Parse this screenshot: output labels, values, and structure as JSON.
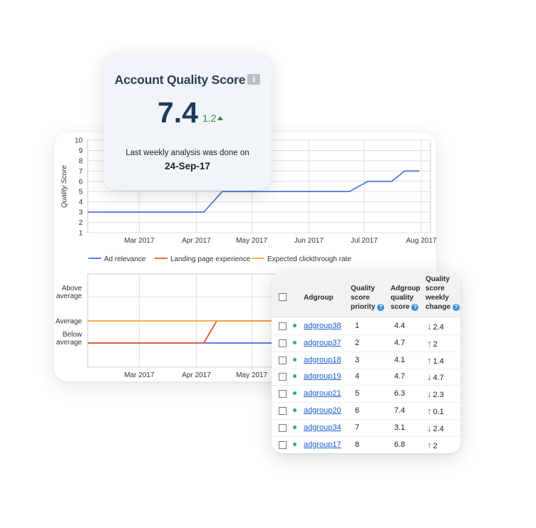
{
  "score_card": {
    "title": "Account Quality Score",
    "info_icon": "info-icon",
    "score": "7.4",
    "change": "1.2",
    "change_direction": "up",
    "note": "Last weekly analysis was done on",
    "date": "24-Sep-17"
  },
  "chart_data": [
    {
      "type": "line",
      "ylabel": "Quality Score",
      "ylim": [
        1,
        10
      ],
      "yticks": [
        "1",
        "2",
        "3",
        "4",
        "5",
        "6",
        "7",
        "8",
        "9",
        "10"
      ],
      "xticks": [
        "Mar 2017",
        "Apr 2017",
        "May 2017",
        "Jun 2017",
        "Jul 2017",
        "Aug 2017"
      ],
      "xlim": [
        "2017-02-01",
        "2017-08-06"
      ],
      "grid": true,
      "series": [
        {
          "color": "#3b6fd4",
          "x": [
            "2017-02-01",
            "2017-04-05",
            "2017-04-15",
            "2017-06-23",
            "2017-07-03",
            "2017-07-16",
            "2017-07-23",
            "2017-07-31"
          ],
          "y": [
            3,
            3,
            5,
            5,
            6,
            6,
            7,
            7
          ]
        }
      ]
    },
    {
      "type": "line",
      "yticks": [
        "Above average",
        "Average",
        "Below average"
      ],
      "xticks": [
        "Mar 2017",
        "Apr 2017",
        "May 2017"
      ],
      "legend": [
        "Ad relevance",
        "Landing page experience",
        "Expected clickthrough rate"
      ],
      "legend_position": "top",
      "grid": true,
      "series": [
        {
          "name": "Ad relevance",
          "color": "#3b6fd4",
          "x": [
            "2017-02-01",
            "2017-05-25"
          ],
          "y": [
            "Below average",
            "Below average"
          ]
        },
        {
          "name": "Landing page experience",
          "color": "#e0582b",
          "x": [
            "2017-02-01",
            "2017-04-05",
            "2017-04-12",
            "2017-05-25"
          ],
          "y": [
            "Below average",
            "Below average",
            "Average",
            "Average"
          ]
        },
        {
          "name": "Expected clickthrough rate",
          "color": "#f7a531",
          "x": [
            "2017-02-01",
            "2017-05-25"
          ],
          "y": [
            "Average",
            "Average"
          ]
        }
      ]
    }
  ],
  "table": {
    "headers": {
      "adgroup": "Adgroup",
      "priority": [
        "Quality",
        "score",
        "priority"
      ],
      "score": [
        "Adgroup",
        "quality",
        "score"
      ],
      "change": [
        "Quality",
        "score",
        "weekly",
        "change"
      ]
    },
    "help_icon": "help-icon",
    "rows": [
      {
        "name": "adgroup38",
        "priority": "1",
        "score": "4.4",
        "direction": "down",
        "change": "2.4"
      },
      {
        "name": "adgroup37",
        "priority": "2",
        "score": "4.7",
        "direction": "up",
        "change": "2"
      },
      {
        "name": "adgroup18",
        "priority": "3",
        "score": "4.1",
        "direction": "up",
        "change": "1.4"
      },
      {
        "name": "adgroup19",
        "priority": "4",
        "score": "4.7",
        "direction": "down",
        "change": "4.7"
      },
      {
        "name": "adgroup21",
        "priority": "5",
        "score": "6.3",
        "direction": "down",
        "change": "2.3"
      },
      {
        "name": "adgroup20",
        "priority": "6",
        "score": "7.4",
        "direction": "up",
        "change": "0.1"
      },
      {
        "name": "adgroup34",
        "priority": "7",
        "score": "3.1",
        "direction": "down",
        "change": "2.4"
      },
      {
        "name": "adgroup17",
        "priority": "8",
        "score": "6.8",
        "direction": "up",
        "change": "2"
      }
    ],
    "status_color": "#1fb868",
    "up_color": "#1e9e3a",
    "down_color": "#d0261e"
  }
}
